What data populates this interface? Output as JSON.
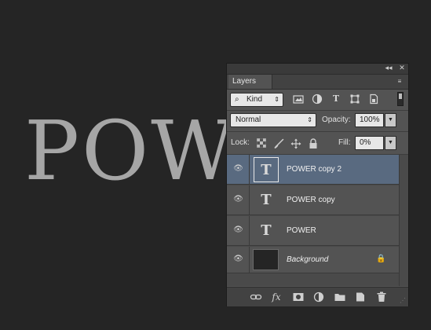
{
  "canvas": {
    "text": "POWER"
  },
  "panel": {
    "collapse_icon": "◂◂",
    "close_icon": "✕",
    "tab_label": "Layers",
    "menu_icon": "≡",
    "filter": {
      "kind_icon": "⌕",
      "kind_label": "Kind",
      "kind_arrow": "⇕",
      "icons": [
        "pixel-filter-icon",
        "adjustment-filter-icon",
        "type-filter-icon",
        "shape-filter-icon",
        "smart-object-filter-icon"
      ]
    },
    "blend_mode": "Normal",
    "blend_arrow": "⇕",
    "opacity_label": "Opacity:",
    "opacity_value": "100%",
    "lock_label": "Lock:",
    "fill_label": "Fill:",
    "fill_value": "0%",
    "dropdown_arrow": "▼"
  },
  "layers": [
    {
      "name": "POWER copy 2",
      "type": "text",
      "selected": true,
      "thumb": "T",
      "eye": "👁"
    },
    {
      "name": "POWER copy",
      "type": "text",
      "selected": false,
      "thumb": "T",
      "eye": "👁"
    },
    {
      "name": "POWER",
      "type": "text",
      "selected": false,
      "thumb": "T",
      "eye": "👁"
    },
    {
      "name": "Background",
      "type": "background",
      "selected": false,
      "locked": true,
      "eye": "👁",
      "lock_glyph": "🔒"
    }
  ],
  "bottom_bar": {
    "fx_label": "fx"
  },
  "colors": {
    "canvas_bg": "#252525",
    "canvas_text": "#a6a6a6",
    "panel_bg": "#535353",
    "selection": "#596a80"
  }
}
